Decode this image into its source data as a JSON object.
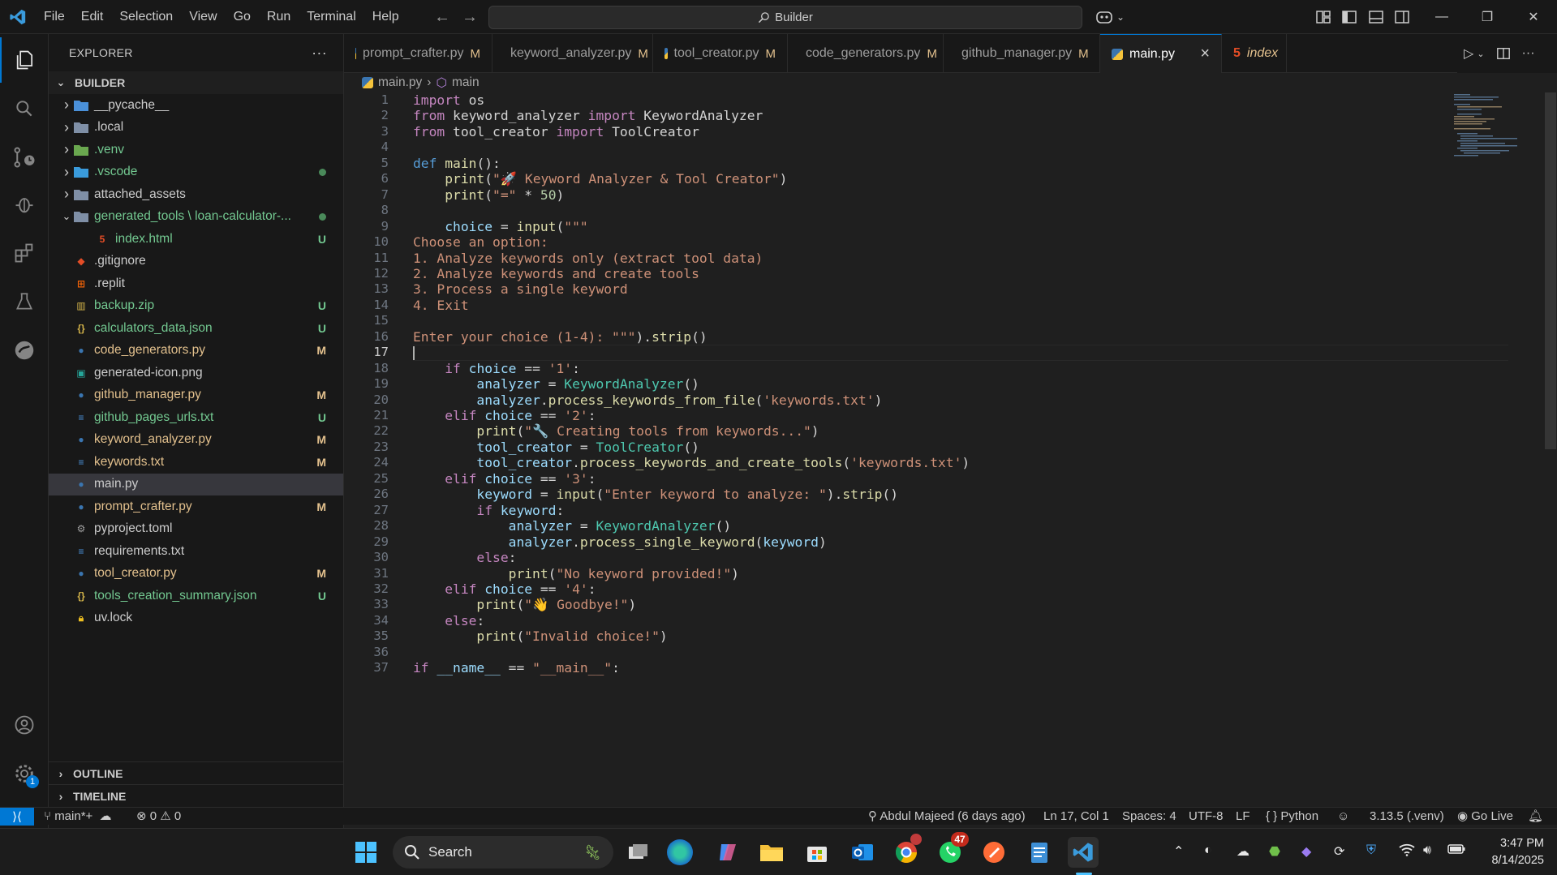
{
  "menu": [
    "File",
    "Edit",
    "Selection",
    "View",
    "Go",
    "Run",
    "Terminal",
    "Help"
  ],
  "search": {
    "label": "Builder"
  },
  "explorer": {
    "title": "EXPLORER",
    "more": "···",
    "root": "BUILDER",
    "items": [
      {
        "label": "__pycache__",
        "type": "folder",
        "status": ""
      },
      {
        "label": ".local",
        "type": "folder",
        "status": ""
      },
      {
        "label": ".venv",
        "type": "folder",
        "status": ""
      },
      {
        "label": ".vscode",
        "type": "folder",
        "status": "dot"
      },
      {
        "label": "attached_assets",
        "type": "folder",
        "status": ""
      },
      {
        "label": "generated_tools \\ loan-calculator-...",
        "type": "folder-open",
        "status": "dot"
      },
      {
        "label": "index.html",
        "type": "html",
        "status": "U"
      },
      {
        "label": ".gitignore",
        "type": "git",
        "status": ""
      },
      {
        "label": ".replit",
        "type": "replit",
        "status": ""
      },
      {
        "label": "backup.zip",
        "type": "zip",
        "status": "U"
      },
      {
        "label": "calculators_data.json",
        "type": "json",
        "status": "U"
      },
      {
        "label": "code_generators.py",
        "type": "py",
        "status": "M"
      },
      {
        "label": "generated-icon.png",
        "type": "png",
        "status": ""
      },
      {
        "label": "github_manager.py",
        "type": "py",
        "status": "M"
      },
      {
        "label": "github_pages_urls.txt",
        "type": "txt",
        "status": "U"
      },
      {
        "label": "keyword_analyzer.py",
        "type": "py",
        "status": "M"
      },
      {
        "label": "keywords.txt",
        "type": "txt",
        "status": "M"
      },
      {
        "label": "main.py",
        "type": "py",
        "status": ""
      },
      {
        "label": "prompt_crafter.py",
        "type": "py",
        "status": "M"
      },
      {
        "label": "pyproject.toml",
        "type": "toml",
        "status": ""
      },
      {
        "label": "requirements.txt",
        "type": "txt",
        "status": ""
      },
      {
        "label": "tool_creator.py",
        "type": "py",
        "status": "M"
      },
      {
        "label": "tools_creation_summary.json",
        "type": "json",
        "status": "U"
      },
      {
        "label": "uv.lock",
        "type": "lock",
        "status": ""
      }
    ],
    "outline": "OUTLINE",
    "timeline": "TIMELINE"
  },
  "tabs": [
    {
      "label": "prompt_crafter.py",
      "status": "M"
    },
    {
      "label": "keyword_analyzer.py",
      "status": "M"
    },
    {
      "label": "tool_creator.py",
      "status": "M"
    },
    {
      "label": "code_generators.py",
      "status": "M"
    },
    {
      "label": "github_manager.py",
      "status": "M"
    },
    {
      "label": "main.py",
      "status": "×"
    },
    {
      "label": "index",
      "status": ""
    }
  ],
  "breadcrumb": {
    "file": "main.py",
    "symbol": "main"
  },
  "code": [
    [
      [
        "kw2",
        "import"
      ],
      [
        "txt",
        " os"
      ]
    ],
    [
      [
        "kw2",
        "from"
      ],
      [
        "txt",
        " keyword_analyzer "
      ],
      [
        "kw2",
        "import"
      ],
      [
        "txt",
        " KeywordAnalyzer"
      ]
    ],
    [
      [
        "kw2",
        "from"
      ],
      [
        "txt",
        " tool_creator "
      ],
      [
        "kw2",
        "import"
      ],
      [
        "txt",
        " ToolCreator"
      ]
    ],
    [],
    [
      [
        "kw",
        "def"
      ],
      [
        "txt",
        " "
      ],
      [
        "fn",
        "main"
      ],
      [
        "txt",
        "():"
      ]
    ],
    [
      [
        "txt",
        "    "
      ],
      [
        "fn",
        "print"
      ],
      [
        "txt",
        "("
      ],
      [
        "str",
        "\"🚀 Keyword Analyzer & Tool Creator\""
      ],
      [
        "txt",
        ")"
      ]
    ],
    [
      [
        "txt",
        "    "
      ],
      [
        "fn",
        "print"
      ],
      [
        "txt",
        "("
      ],
      [
        "str",
        "\"=\""
      ],
      [
        "txt",
        " * "
      ],
      [
        "num",
        "50"
      ],
      [
        "txt",
        ")"
      ]
    ],
    [],
    [
      [
        "txt",
        "    "
      ],
      [
        "var",
        "choice"
      ],
      [
        "txt",
        " = "
      ],
      [
        "fn",
        "input"
      ],
      [
        "txt",
        "("
      ],
      [
        "str",
        "\"\"\""
      ]
    ],
    [
      [
        "str",
        "Choose an option:"
      ]
    ],
    [
      [
        "str",
        "1. Analyze keywords only (extract tool data)"
      ]
    ],
    [
      [
        "str",
        "2. Analyze keywords and create tools"
      ]
    ],
    [
      [
        "str",
        "3. Process a single keyword"
      ]
    ],
    [
      [
        "str",
        "4. Exit"
      ]
    ],
    [],
    [
      [
        "str",
        "Enter your choice (1-4): \"\"\""
      ],
      [
        "txt",
        ")."
      ],
      [
        "fn",
        "strip"
      ],
      [
        "txt",
        "()"
      ]
    ],
    [],
    [
      [
        "txt",
        "    "
      ],
      [
        "kw2",
        "if"
      ],
      [
        "txt",
        " "
      ],
      [
        "var",
        "choice"
      ],
      [
        "txt",
        " == "
      ],
      [
        "str",
        "'1'"
      ],
      [
        "txt",
        ":"
      ]
    ],
    [
      [
        "txt",
        "        "
      ],
      [
        "var",
        "analyzer"
      ],
      [
        "txt",
        " = "
      ],
      [
        "cls",
        "KeywordAnalyzer"
      ],
      [
        "txt",
        "()"
      ]
    ],
    [
      [
        "txt",
        "        "
      ],
      [
        "var",
        "analyzer"
      ],
      [
        "txt",
        "."
      ],
      [
        "fn",
        "process_keywords_from_file"
      ],
      [
        "txt",
        "("
      ],
      [
        "str",
        "'keywords.txt'"
      ],
      [
        "txt",
        ")"
      ]
    ],
    [
      [
        "txt",
        "    "
      ],
      [
        "kw2",
        "elif"
      ],
      [
        "txt",
        " "
      ],
      [
        "var",
        "choice"
      ],
      [
        "txt",
        " == "
      ],
      [
        "str",
        "'2'"
      ],
      [
        "txt",
        ":"
      ]
    ],
    [
      [
        "txt",
        "        "
      ],
      [
        "fn",
        "print"
      ],
      [
        "txt",
        "("
      ],
      [
        "str",
        "\"🔧 Creating tools from keywords...\""
      ],
      [
        "txt",
        ")"
      ]
    ],
    [
      [
        "txt",
        "        "
      ],
      [
        "var",
        "tool_creator"
      ],
      [
        "txt",
        " = "
      ],
      [
        "cls",
        "ToolCreator"
      ],
      [
        "txt",
        "()"
      ]
    ],
    [
      [
        "txt",
        "        "
      ],
      [
        "var",
        "tool_creator"
      ],
      [
        "txt",
        "."
      ],
      [
        "fn",
        "process_keywords_and_create_tools"
      ],
      [
        "txt",
        "("
      ],
      [
        "str",
        "'keywords.txt'"
      ],
      [
        "txt",
        ")"
      ]
    ],
    [
      [
        "txt",
        "    "
      ],
      [
        "kw2",
        "elif"
      ],
      [
        "txt",
        " "
      ],
      [
        "var",
        "choice"
      ],
      [
        "txt",
        " == "
      ],
      [
        "str",
        "'3'"
      ],
      [
        "txt",
        ":"
      ]
    ],
    [
      [
        "txt",
        "        "
      ],
      [
        "var",
        "keyword"
      ],
      [
        "txt",
        " = "
      ],
      [
        "fn",
        "input"
      ],
      [
        "txt",
        "("
      ],
      [
        "str",
        "\"Enter keyword to analyze: \""
      ],
      [
        "txt",
        ")."
      ],
      [
        "fn",
        "strip"
      ],
      [
        "txt",
        "()"
      ]
    ],
    [
      [
        "txt",
        "        "
      ],
      [
        "kw2",
        "if"
      ],
      [
        "txt",
        " "
      ],
      [
        "var",
        "keyword"
      ],
      [
        "txt",
        ":"
      ]
    ],
    [
      [
        "txt",
        "            "
      ],
      [
        "var",
        "analyzer"
      ],
      [
        "txt",
        " = "
      ],
      [
        "cls",
        "KeywordAnalyzer"
      ],
      [
        "txt",
        "()"
      ]
    ],
    [
      [
        "txt",
        "            "
      ],
      [
        "var",
        "analyzer"
      ],
      [
        "txt",
        "."
      ],
      [
        "fn",
        "process_single_keyword"
      ],
      [
        "txt",
        "("
      ],
      [
        "var",
        "keyword"
      ],
      [
        "txt",
        ")"
      ]
    ],
    [
      [
        "txt",
        "        "
      ],
      [
        "kw2",
        "else"
      ],
      [
        "txt",
        ":"
      ]
    ],
    [
      [
        "txt",
        "            "
      ],
      [
        "fn",
        "print"
      ],
      [
        "txt",
        "("
      ],
      [
        "str",
        "\"No keyword provided!\""
      ],
      [
        "txt",
        ")"
      ]
    ],
    [
      [
        "txt",
        "    "
      ],
      [
        "kw2",
        "elif"
      ],
      [
        "txt",
        " "
      ],
      [
        "var",
        "choice"
      ],
      [
        "txt",
        " == "
      ],
      [
        "str",
        "'4'"
      ],
      [
        "txt",
        ":"
      ]
    ],
    [
      [
        "txt",
        "        "
      ],
      [
        "fn",
        "print"
      ],
      [
        "txt",
        "("
      ],
      [
        "str",
        "\"👋 Goodbye!\""
      ],
      [
        "txt",
        ")"
      ]
    ],
    [
      [
        "txt",
        "    "
      ],
      [
        "kw2",
        "else"
      ],
      [
        "txt",
        ":"
      ]
    ],
    [
      [
        "txt",
        "        "
      ],
      [
        "fn",
        "print"
      ],
      [
        "txt",
        "("
      ],
      [
        "str",
        "\"Invalid choice!\""
      ],
      [
        "txt",
        ")"
      ]
    ],
    [],
    [
      [
        "kw2",
        "if"
      ],
      [
        "txt",
        " "
      ],
      [
        "var",
        "__name__"
      ],
      [
        "txt",
        " == "
      ],
      [
        "str",
        "\"__main__\""
      ],
      [
        "txt",
        ":"
      ]
    ]
  ],
  "current_line": 17,
  "status": {
    "branch": "main*+",
    "errors": "0",
    "warnings": "0",
    "author": "Abdul Majeed (6 days ago)",
    "position": "Ln 17, Col 1",
    "spaces": "Spaces: 4",
    "encoding": "UTF-8",
    "eol": "LF",
    "language": "Python",
    "interpreter": "3.13.5 (.venv)",
    "golive": "Go Live"
  },
  "taskbar": {
    "search": "Search",
    "whatsapp_badge": "47",
    "time": "3:47 PM",
    "date": "8/14/2025"
  },
  "colors": {
    "accent": "#0078d4",
    "modified": "#e2c08d",
    "untracked": "#73c991"
  }
}
